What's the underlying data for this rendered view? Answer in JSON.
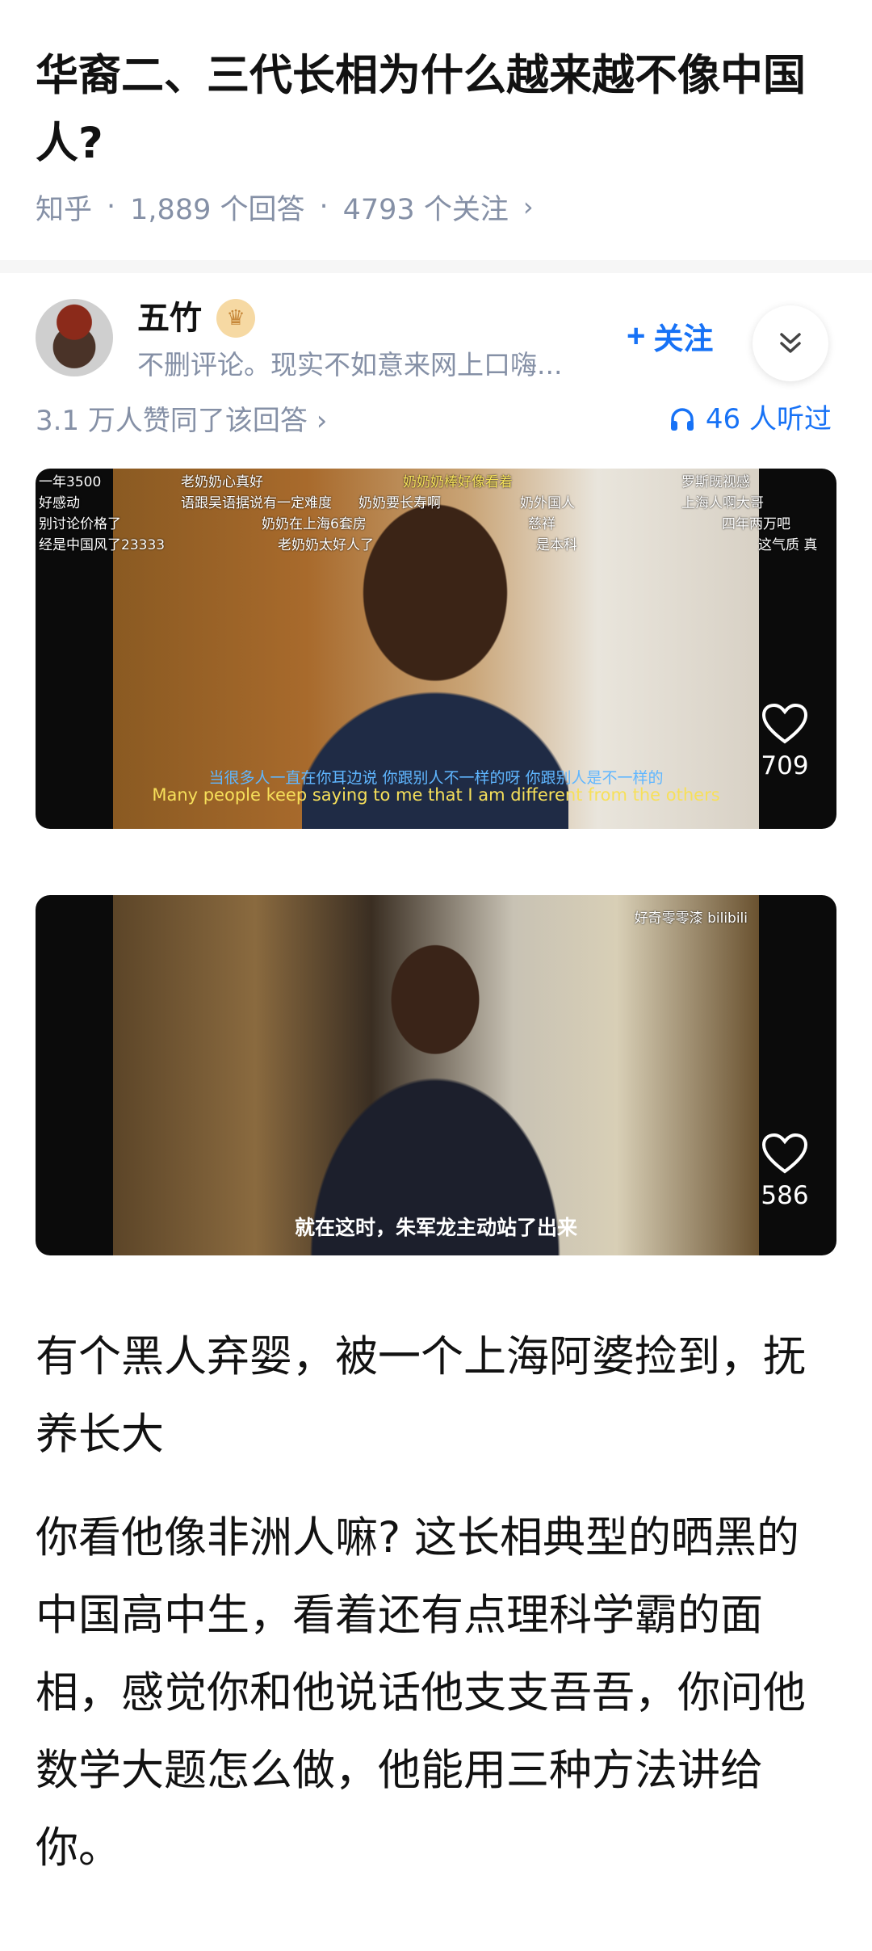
{
  "question": {
    "title": "华裔二、三代长相为什么越来越不像中国人?",
    "source": "知乎",
    "answers": "1,889 个回答",
    "followers": "4793 个关注"
  },
  "author": {
    "name": "五竹",
    "bio": "不删评论。现实不如意来网上口嗨...",
    "follow_label": "关注"
  },
  "answer_meta": {
    "likes": "3.1 万人赞同了该回答",
    "listened": "46 人听过"
  },
  "video1": {
    "danmaku": [
      "一年3500",
      "老奶奶心真好",
      "奶奶奶棒好像看着",
      "罗斯既视感",
      "好感动",
      "语跟吴语据说有一定难度",
      "奶奶要长寿啊",
      "奶外国人",
      "上海人啊大哥",
      "别讨论价格了",
      "奶奶在上海6套房",
      "慈祥",
      "四年两万吧",
      "经是中国风了23333",
      "老奶奶太好人了",
      "是本科",
      "这气质 真"
    ],
    "subtitle_cn": "当很多人一直在你耳边说 你跟别人不一样的呀 你跟别人是不一样的",
    "subtitle_en": "Many people keep saying to me that I am different from the others",
    "likes": "709"
  },
  "video2": {
    "subtitle": "就在这时，朱军龙主动站了出来",
    "likes": "586",
    "watermark": "好奇零零漆 bilibili"
  },
  "content": {
    "p1": "有个黑人弃婴，被一个上海阿婆捡到，抚养长大",
    "p2": "你看他像非洲人嘛? 这长相典型的晒黑的中国高中生，看着还有点理科学霸的面相，感觉你和他说话他支支吾吾，你问他数学大题怎么做，他能用三种方法讲给你。"
  },
  "colors": {
    "brand_blue": "#1772f6",
    "meta_gray": "#8590a6"
  }
}
